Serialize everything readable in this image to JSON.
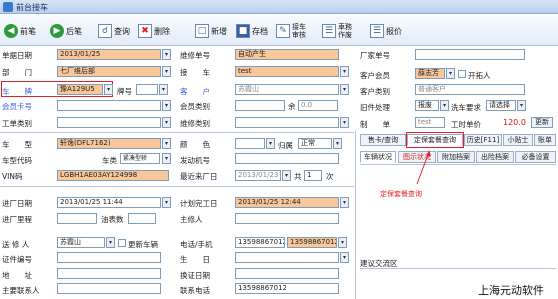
{
  "window": {
    "title": "前台接车"
  },
  "toolbar": {
    "prev": "前笔",
    "next": "后笔",
    "query": "查询",
    "delete": "删除",
    "new": "新增",
    "save": "存档",
    "audit_1": "接车",
    "audit_2": "审核",
    "clear_1": "車務",
    "clear_2": "作废",
    "quote": "报价"
  },
  "form": {
    "date_label": "单据日期",
    "date": "2013/01/25",
    "dept_label": "部　　门",
    "dept": "七厂维后部",
    "plate_label": "车　　牌",
    "plate": "豫A129U5",
    "plate_num_label": "牌号",
    "member_card_label": "会员卡号",
    "workorder_label": "工单类别",
    "model_label": "车　　型",
    "model": "轩逸(DFL7162)",
    "model_code_label": "车型代码",
    "car_type_label": "车类",
    "car_type": "紧凑型轿",
    "vin_label": "VIN码",
    "vin": "LGBH1AE03AY124998",
    "in_date_label": "进厂日期",
    "in_date": "2013/01/25 11:44",
    "in_mileage_label": "进厂里程",
    "fuel_label": "油表数",
    "sender_label": "送 修 人",
    "sender": "苏霞山",
    "update_car_label": "更新车辆",
    "cert_label": "证件编号",
    "address_label": "地　　址",
    "contact_label": "主要联系人",
    "repair_no_label": "维修单号",
    "repair_no": "自动产生",
    "pickup_label": "接　　车",
    "pickup": "test",
    "customer_label": "客　　户",
    "customer": "苏霞山",
    "member_type_label": "会员类别",
    "balance_label": "余",
    "balance": "0.0",
    "repair_type_label": "维修类别",
    "color_label": "颜　　色",
    "attr_label": "归属",
    "attr": "正常",
    "engine_label": "发动机号",
    "last_in_label": "最近来厂日",
    "last_in": "2013/01/23",
    "times_label": "共",
    "times": "1",
    "times_unit": "次",
    "planned_label": "计划完工日",
    "planned": "2013/01/25 12:44",
    "supervisor_label": "主修人",
    "phone_label": "电话/手机",
    "phone": "13598867012",
    "mobile": "13598867012",
    "birthday_label": "生　　日",
    "license_date_label": "换证日期",
    "contact_phone_label": "联系电话",
    "contact_phone": "13598867012",
    "factory_no_label": "厂家单号",
    "cust_member_label": "客户会员",
    "cust_member": "薛志芳",
    "opener_label": "开拓人",
    "cust_type_label": "客户类别",
    "cust_type": "普通客户",
    "old_parts_label": "旧件处理",
    "old_parts": "报废",
    "wash_label": "洗车要求",
    "wash": "请选择",
    "maker_label": "制　　单",
    "maker": "test",
    "labor_price_label": "工时单价",
    "labor_price": "120.0",
    "update_btn": "更新"
  },
  "tabs": {
    "row1": [
      "售卡/查询",
      "定保套餐查询",
      "历史[F11]",
      "小贴士",
      "账单"
    ],
    "row2": [
      "车辆状况",
      "图示状况",
      "附加档案",
      "出险档案",
      "必备设置"
    ]
  },
  "suggestion_label": "建议交流区",
  "annotation": "定保套餐查询",
  "watermark": "上海元动软件"
}
